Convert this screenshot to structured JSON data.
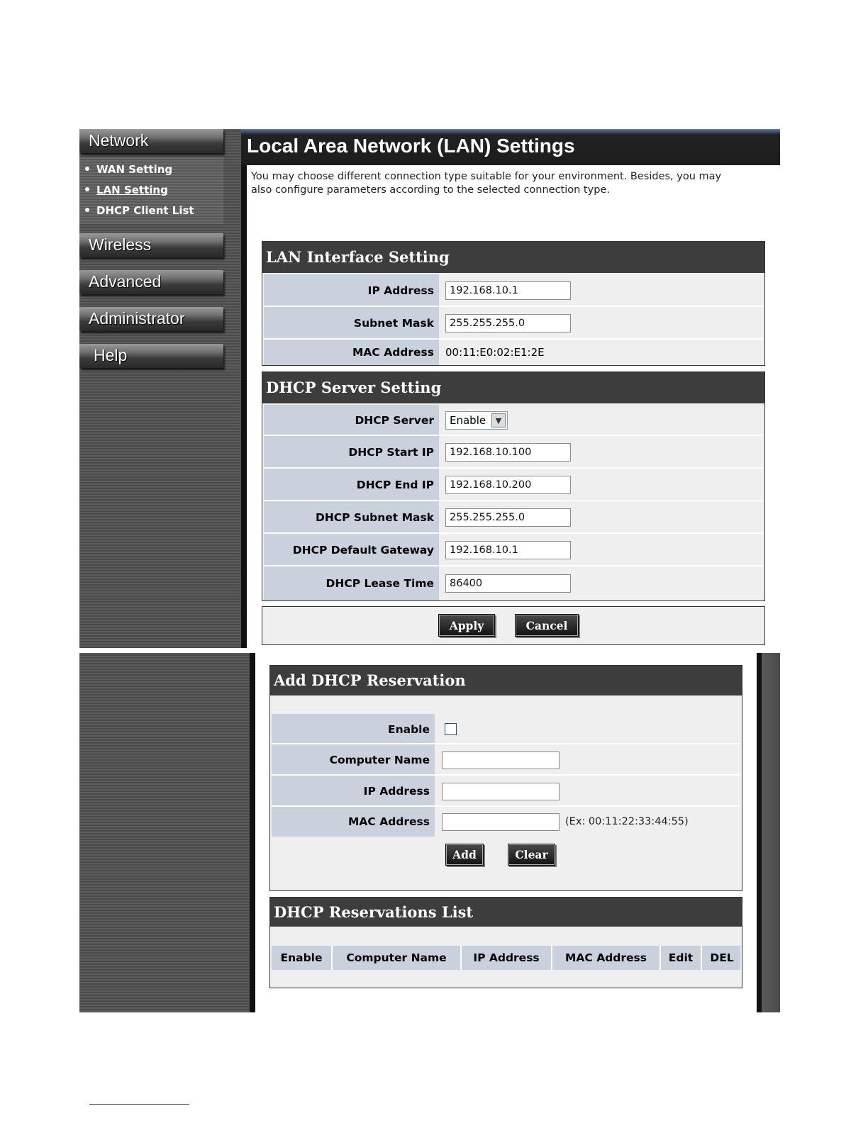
{
  "sidebar": {
    "menus": [
      {
        "label": "Network"
      },
      {
        "label": "Wireless"
      },
      {
        "label": "Advanced"
      },
      {
        "label": "Administrator"
      },
      {
        "label": "Help"
      }
    ],
    "network_items": [
      {
        "label": "WAN Setting",
        "active": false
      },
      {
        "label": "LAN Setting",
        "active": true
      },
      {
        "label": "DHCP Client List",
        "active": false
      }
    ]
  },
  "page": {
    "title": "Local Area Network (LAN) Settings",
    "intro": "You may choose different connection type suitable for your environment. Besides, you may also configure parameters according to the selected connection type."
  },
  "lan_interface": {
    "heading": "LAN Interface Setting",
    "ip_label": "IP Address",
    "ip_value": "192.168.10.1",
    "mask_label": "Subnet Mask",
    "mask_value": "255.255.255.0",
    "mac_label": "MAC Address",
    "mac_value": "00:11:E0:02:E1:2E"
  },
  "dhcp_server": {
    "heading": "DHCP Server Setting",
    "server_label": "DHCP Server",
    "server_value": "Enable",
    "start_label": "DHCP Start IP",
    "start_value": "192.168.10.100",
    "end_label": "DHCP End IP",
    "end_value": "192.168.10.200",
    "mask_label": "DHCP Subnet Mask",
    "mask_value": "255.255.255.0",
    "gateway_label": "DHCP Default Gateway",
    "gateway_value": "192.168.10.1",
    "lease_label": "DHCP Lease Time",
    "lease_value": "86400"
  },
  "actions": {
    "apply": "Apply",
    "cancel": "Cancel"
  },
  "reservation": {
    "heading": "Add DHCP Reservation",
    "enable_label": "Enable",
    "name_label": "Computer Name",
    "ip_label": "IP Address",
    "mac_label": "MAC Address",
    "mac_hint": "(Ex: 00:11:22:33:44:55)",
    "add": "Add",
    "clear": "Clear"
  },
  "reservation_list": {
    "heading": "DHCP Reservations List",
    "columns": [
      "Enable",
      "Computer Name",
      "IP Address",
      "MAC Address",
      "Edit",
      "DEL"
    ]
  }
}
